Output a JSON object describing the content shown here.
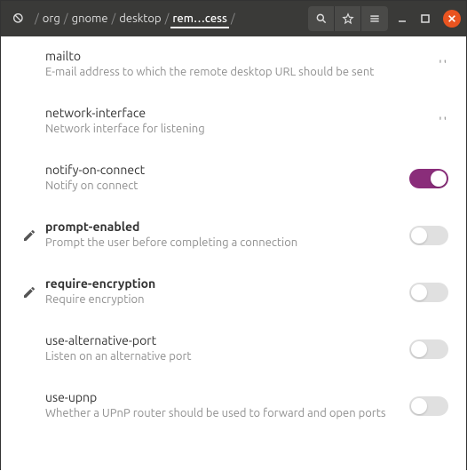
{
  "breadcrumb": {
    "p0": "org",
    "p1": "gnome",
    "p2": "desktop",
    "p3": "rem…cess"
  },
  "rows": [
    {
      "key": "mailto",
      "desc": "E-mail address to which the remote desktop URL should be sent",
      "bold": false,
      "edited": false,
      "type": "string",
      "value": "''"
    },
    {
      "key": "network-interface",
      "desc": "Network interface for listening",
      "bold": false,
      "edited": false,
      "type": "string",
      "value": "''"
    },
    {
      "key": "notify-on-connect",
      "desc": "Notify on connect",
      "bold": false,
      "edited": false,
      "type": "bool",
      "value": true
    },
    {
      "key": "prompt-enabled",
      "desc": "Prompt the user before completing a connection",
      "bold": true,
      "edited": true,
      "type": "bool",
      "value": false
    },
    {
      "key": "require-encryption",
      "desc": "Require encryption",
      "bold": true,
      "edited": true,
      "type": "bool",
      "value": false
    },
    {
      "key": "use-alternative-port",
      "desc": "Listen on an alternative port",
      "bold": false,
      "edited": false,
      "type": "bool",
      "value": false
    },
    {
      "key": "use-upnp",
      "desc": "Whether a UPnP router should be used to forward and open ports",
      "bold": false,
      "edited": false,
      "type": "bool",
      "value": false
    }
  ]
}
